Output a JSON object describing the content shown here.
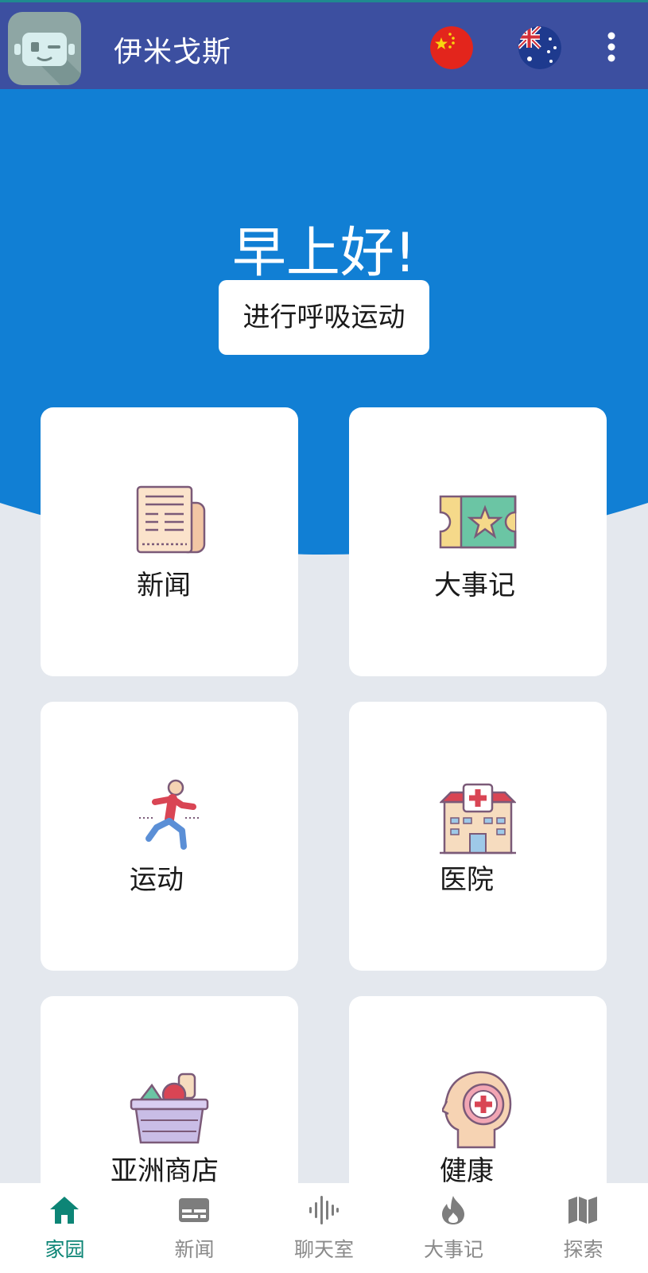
{
  "app_bar": {
    "title": "伊米戈斯",
    "logo_icon": "robot-logo-icon",
    "language_flags": [
      "china-flag-icon",
      "australia-flag-icon"
    ],
    "menu_icon": "more-vertical-icon",
    "background": "#3c4fa0"
  },
  "hero": {
    "greeting": "早上好!",
    "button_label": "进行呼吸运动",
    "background": "#117fd4"
  },
  "cards": [
    {
      "label": "新闻",
      "icon": "newspaper-icon"
    },
    {
      "label": "大事记",
      "icon": "ticket-star-icon"
    },
    {
      "label": "运动",
      "icon": "running-person-icon"
    },
    {
      "label": "医院",
      "icon": "hospital-icon"
    },
    {
      "label": "亚洲商店",
      "icon": "grocery-basket-icon"
    },
    {
      "label": "健康",
      "icon": "head-medical-cross-icon"
    }
  ],
  "bottom_nav": {
    "active_index": 0,
    "accent": "#0d8576",
    "items": [
      {
        "label": "家园",
        "icon": "home-icon"
      },
      {
        "label": "新闻",
        "icon": "news-card-icon"
      },
      {
        "label": "聊天室",
        "icon": "sound-wave-icon"
      },
      {
        "label": "大事记",
        "icon": "flame-icon"
      },
      {
        "label": "探索",
        "icon": "map-icon"
      }
    ]
  }
}
